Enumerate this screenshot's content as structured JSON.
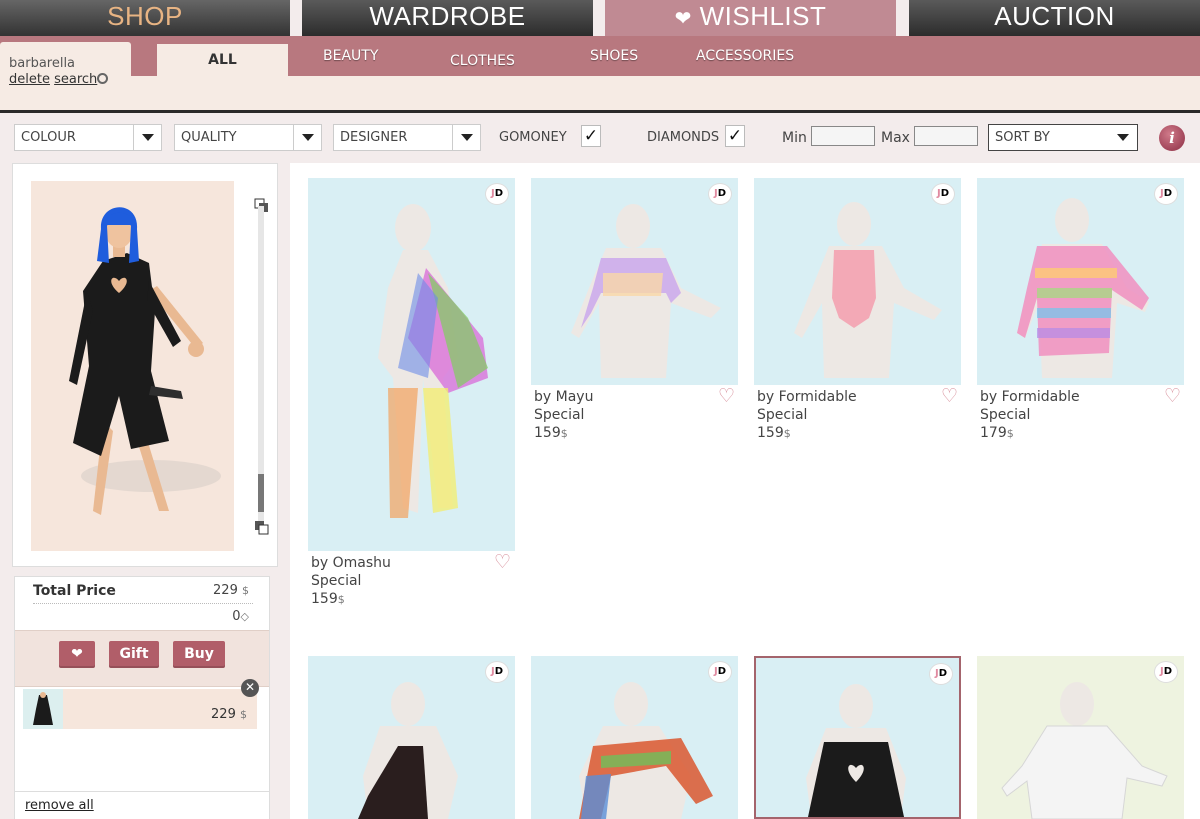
{
  "nav": {
    "tabs": [
      {
        "label": "SHOP"
      },
      {
        "label": "WARDROBE"
      },
      {
        "label": "WISHLIST"
      },
      {
        "label": "AUCTION"
      }
    ]
  },
  "user": {
    "name": "barbarella",
    "delete_label": "delete",
    "search_label": "search"
  },
  "categories": [
    {
      "label": "ALL"
    },
    {
      "label": "BEAUTY"
    },
    {
      "label": "CLOTHES"
    },
    {
      "label": "SHOES"
    },
    {
      "label": "ACCESSORIES"
    }
  ],
  "filters": {
    "colour": "COLOUR",
    "quality": "QUALITY",
    "designer": "DESIGNER",
    "gomoney": "GOMONEY",
    "diamonds": "DIAMONDS",
    "check": "✓",
    "min_label": "Min",
    "max_label": "Max",
    "sort_by": "SORT BY",
    "info": "i"
  },
  "summary": {
    "total_label": "Total Price",
    "total_value": "229",
    "diamond_value": "0",
    "gift_label": "Gift",
    "buy_label": "Buy",
    "cart_item_price": "229",
    "remove_all": "remove all"
  },
  "products": [
    {
      "designer": "by Omashu",
      "category": "Special",
      "price": "159"
    },
    {
      "designer": "by Mayu",
      "category": "Special",
      "price": "159"
    },
    {
      "designer": "by Formidable",
      "category": "Special",
      "price": "159"
    },
    {
      "designer": "by Formidable",
      "category": "Special",
      "price": "179"
    }
  ],
  "brand_badge": "JD",
  "colors": {
    "accent_pink": "#b8787f",
    "button_red": "#b15e69",
    "card_blue": "#d9eff4"
  }
}
